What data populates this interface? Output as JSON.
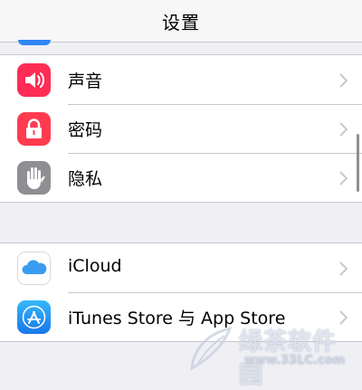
{
  "nav": {
    "title": "设置"
  },
  "group1": [
    {
      "label": "声音",
      "icon": "speaker-icon",
      "color": "#ff2d55"
    },
    {
      "label": "密码",
      "icon": "lock-icon",
      "color": "#ff3b50"
    },
    {
      "label": "隐私",
      "icon": "hand-icon",
      "color": "#8e8e93"
    }
  ],
  "group2": [
    {
      "label": "iCloud",
      "icon": "icloud-icon",
      "color": "#ffffff"
    },
    {
      "label": "iTunes Store 与 App Store",
      "icon": "app-store-icon",
      "color": "#1f8ff0"
    }
  ],
  "watermark": {
    "text": "绿茶软件园",
    "url": "www.33LC.com"
  }
}
